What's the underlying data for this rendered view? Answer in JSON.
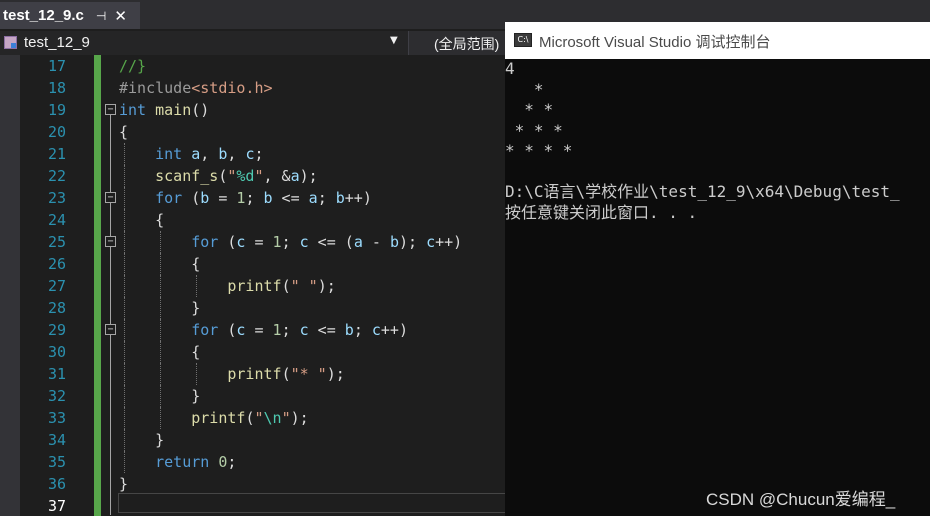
{
  "editor": {
    "tab": {
      "title": "test_12_9.c",
      "pin_glyph": "⊣",
      "close_glyph": "✕"
    },
    "navbar": {
      "project": "test_12_9",
      "scope": "(全局范围)"
    },
    "lines": [
      {
        "num": "17",
        "html": "<span class=\"cmt\">//}</span>"
      },
      {
        "num": "18",
        "html": "<span class=\"pp\">#include</span><span class=\"inc\">&lt;stdio.h&gt;</span>"
      },
      {
        "num": "19",
        "html": "<span class=\"kw\">int</span> <span class=\"fn\">main</span>()"
      },
      {
        "num": "20",
        "html": "{"
      },
      {
        "num": "21",
        "html": "    <span class=\"kw\">int</span> <span class=\"var\">a</span>, <span class=\"var\">b</span>, <span class=\"var\">c</span>;"
      },
      {
        "num": "22",
        "html": "    <span class=\"fn\">scanf_s</span>(<span class=\"str\">\"</span><span class=\"fmt\">%d</span><span class=\"str\">\"</span>, &amp;<span class=\"var\">a</span>);"
      },
      {
        "num": "23",
        "html": "    <span class=\"kw\">for</span> (<span class=\"var\">b</span> = <span class=\"num\">1</span>; <span class=\"var\">b</span> &lt;= <span class=\"var\">a</span>; <span class=\"var\">b</span>++)"
      },
      {
        "num": "24",
        "html": "    {"
      },
      {
        "num": "25",
        "html": "        <span class=\"kw\">for</span> (<span class=\"var\">c</span> = <span class=\"num\">1</span>; <span class=\"var\">c</span> &lt;= (<span class=\"var\">a</span> - <span class=\"var\">b</span>); <span class=\"var\">c</span>++)"
      },
      {
        "num": "26",
        "html": "        {"
      },
      {
        "num": "27",
        "html": "            <span class=\"fn\">printf</span>(<span class=\"str\">\" \"</span>);"
      },
      {
        "num": "28",
        "html": "        }"
      },
      {
        "num": "29",
        "html": "        <span class=\"kw\">for</span> (<span class=\"var\">c</span> = <span class=\"num\">1</span>; <span class=\"var\">c</span> &lt;= <span class=\"var\">b</span>; <span class=\"var\">c</span>++)"
      },
      {
        "num": "30",
        "html": "        {"
      },
      {
        "num": "31",
        "html": "            <span class=\"fn\">printf</span>(<span class=\"str\">\"* \"</span>);"
      },
      {
        "num": "32",
        "html": "        }"
      },
      {
        "num": "33",
        "html": "        <span class=\"fn\">printf</span>(<span class=\"str\">\"</span><span class=\"fmt\">\\n</span><span class=\"str\">\"</span>);"
      },
      {
        "num": "34",
        "html": "    }"
      },
      {
        "num": "35",
        "html": "    <span class=\"kw\">return</span> <span class=\"num\">0</span>;"
      },
      {
        "num": "36",
        "html": "}"
      },
      {
        "num": "37",
        "html": ""
      }
    ],
    "fold_lines": [
      "19",
      "23",
      "25",
      "29"
    ],
    "current_line": "37"
  },
  "console": {
    "icon_text": "C:\\",
    "title": "Microsoft Visual Studio 调试控制台",
    "output": [
      "4",
      "   *",
      "  * *",
      " * * *",
      "* * * *",
      "",
      "D:\\C语言\\学校作业\\test_12_9\\x64\\Debug\\test_",
      "按任意键关闭此窗口. . ."
    ],
    "watermark": "CSDN @Chucun爱编程_"
  }
}
